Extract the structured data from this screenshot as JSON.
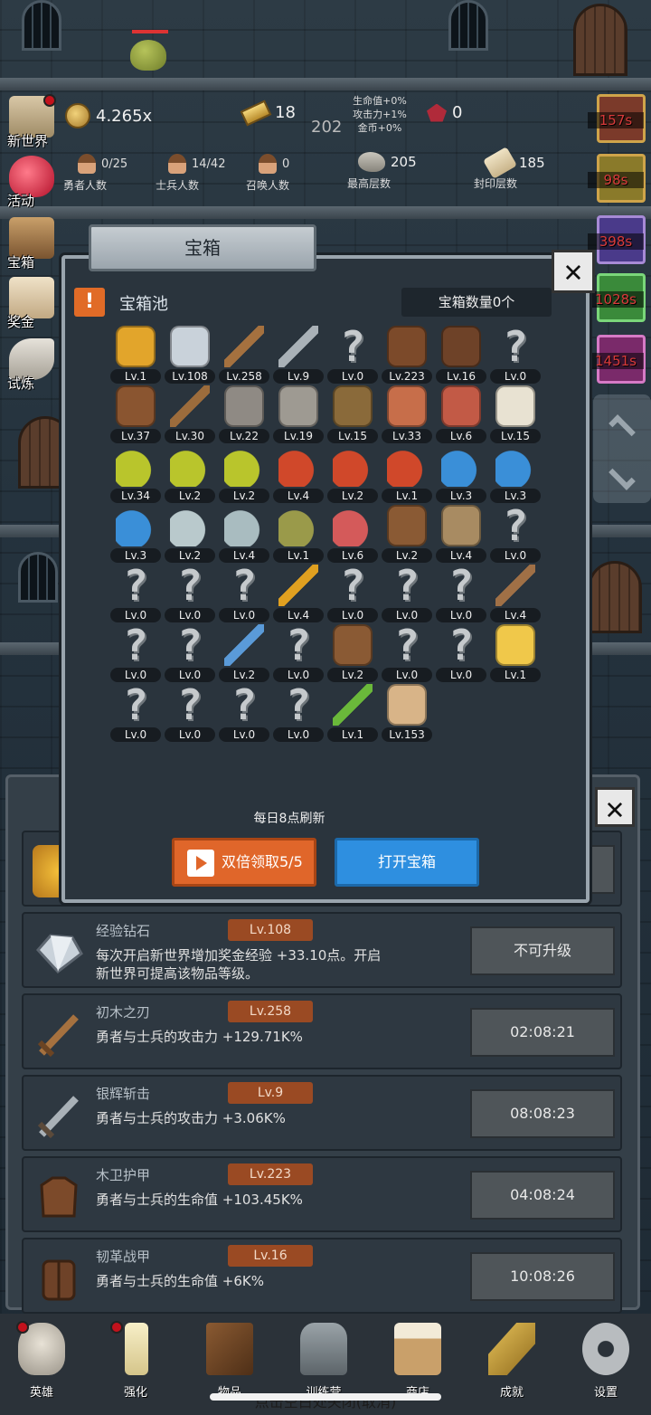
{
  "hud": {
    "gold": "4.265x",
    "bars": "18",
    "floor_center": "202",
    "ruby": "0",
    "bonus": [
      "生命值+0%",
      "攻击力+1%",
      "金币+0%"
    ],
    "heroes": "0/25",
    "heroes_label": "勇者人数",
    "soldiers": "14/42",
    "soldiers_label": "士兵人数",
    "summons": "0",
    "summons_label": "召唤人数",
    "max_floor": "205",
    "max_floor_label": "最高层数",
    "sealed_floor": "185",
    "sealed_floor_label": "封印层数"
  },
  "left_menu": [
    "新世界",
    "活动",
    "宝箱",
    "奖金",
    "试炼"
  ],
  "right_timers": [
    "157s",
    "98s",
    "398s",
    "1028s",
    "1451s"
  ],
  "dialog": {
    "title": "宝箱",
    "pool_title": "宝箱池",
    "count": "宝箱数量0个",
    "refresh": "每日8点刷新",
    "double_btn": "双倍领取5/5",
    "open_btn": "打开宝箱",
    "items": [
      {
        "icon": "crown-icon",
        "lv": "Lv.1"
      },
      {
        "icon": "diamond-icon",
        "lv": "Lv.108"
      },
      {
        "icon": "wood-sword-icon",
        "lv": "Lv.258"
      },
      {
        "icon": "silver-sword-icon",
        "lv": "Lv.9"
      },
      {
        "icon": "unknown-icon",
        "lv": "Lv.0"
      },
      {
        "icon": "leather-armor-icon",
        "lv": "Lv.223"
      },
      {
        "icon": "backpack-armor-icon",
        "lv": "Lv.16"
      },
      {
        "icon": "unknown-icon",
        "lv": "Lv.0"
      },
      {
        "icon": "leather-helmet-icon",
        "lv": "Lv.37"
      },
      {
        "icon": "dagger-icon",
        "lv": "Lv.30"
      },
      {
        "icon": "knight-helmet-icon",
        "lv": "Lv.22"
      },
      {
        "icon": "hammer-icon",
        "lv": "Lv.19"
      },
      {
        "icon": "great-helm-icon",
        "lv": "Lv.15"
      },
      {
        "icon": "ham-icon",
        "lv": "Lv.33"
      },
      {
        "icon": "steak-icon",
        "lv": "Lv.6"
      },
      {
        "icon": "rice-bowl-icon",
        "lv": "Lv.15"
      },
      {
        "icon": "yellow-potion-icon",
        "lv": "Lv.34"
      },
      {
        "icon": "yellow-flask-icon",
        "lv": "Lv.2"
      },
      {
        "icon": "yellow-round-potion-icon",
        "lv": "Lv.2"
      },
      {
        "icon": "red-potion-icon",
        "lv": "Lv.4"
      },
      {
        "icon": "red-flask-icon",
        "lv": "Lv.2"
      },
      {
        "icon": "red-round-potion-icon",
        "lv": "Lv.1"
      },
      {
        "icon": "blue-potion-icon",
        "lv": "Lv.3"
      },
      {
        "icon": "blue-flask-icon",
        "lv": "Lv.3"
      },
      {
        "icon": "blue-round-potion-icon",
        "lv": "Lv.3"
      },
      {
        "icon": "gray-vial-icon",
        "lv": "Lv.2"
      },
      {
        "icon": "gray-bottle-icon",
        "lv": "Lv.4"
      },
      {
        "icon": "green-bottle-icon",
        "lv": "Lv.1"
      },
      {
        "icon": "red-vial-icon",
        "lv": "Lv.6"
      },
      {
        "icon": "leather-boot-icon",
        "lv": "Lv.2"
      },
      {
        "icon": "cloth-boot-icon",
        "lv": "Lv.4"
      },
      {
        "icon": "unknown-icon",
        "lv": "Lv.0"
      },
      {
        "icon": "unknown-icon",
        "lv": "Lv.0"
      },
      {
        "icon": "unknown-icon",
        "lv": "Lv.0"
      },
      {
        "icon": "unknown-icon",
        "lv": "Lv.0"
      },
      {
        "icon": "torch-icon",
        "lv": "Lv.4"
      },
      {
        "icon": "unknown-icon",
        "lv": "Lv.0"
      },
      {
        "icon": "unknown-icon",
        "lv": "Lv.0"
      },
      {
        "icon": "unknown-icon",
        "lv": "Lv.0"
      },
      {
        "icon": "wood-staff-icon",
        "lv": "Lv.4"
      },
      {
        "icon": "unknown-icon",
        "lv": "Lv.0"
      },
      {
        "icon": "unknown-icon",
        "lv": "Lv.0"
      },
      {
        "icon": "blue-wand-icon",
        "lv": "Lv.2"
      },
      {
        "icon": "unknown-icon",
        "lv": "Lv.0"
      },
      {
        "icon": "travel-bag-icon",
        "lv": "Lv.2"
      },
      {
        "icon": "unknown-icon",
        "lv": "Lv.0"
      },
      {
        "icon": "unknown-icon",
        "lv": "Lv.0"
      },
      {
        "icon": "cheese-icon",
        "lv": "Lv.1"
      },
      {
        "icon": "unknown-icon",
        "lv": "Lv.0"
      },
      {
        "icon": "unknown-icon",
        "lv": "Lv.0"
      },
      {
        "icon": "unknown-icon",
        "lv": "Lv.0"
      },
      {
        "icon": "unknown-icon",
        "lv": "Lv.0"
      },
      {
        "icon": "green-wand-icon",
        "lv": "Lv.1"
      },
      {
        "icon": "beer-mug-icon",
        "lv": "Lv.153"
      }
    ]
  },
  "list": [
    {
      "name": "经验钻石",
      "lv": "Lv.108",
      "desc": "每次开启新世界增加奖金经验 +33.10点。开启新世界可提高该物品等级。",
      "btn": "不可升级"
    },
    {
      "name": "初木之刃",
      "lv": "Lv.258",
      "desc": "勇者与士兵的攻击力 +129.71K%",
      "btn": "02:08:21"
    },
    {
      "name": "银辉斩击",
      "lv": "Lv.9",
      "desc": "勇者与士兵的攻击力 +3.06K%",
      "btn": "08:08:23"
    },
    {
      "name": "木卫护甲",
      "lv": "Lv.223",
      "desc": "勇者与士兵的生命值 +103.45K%",
      "btn": "04:08:24"
    },
    {
      "name": "韧革战甲",
      "lv": "Lv.16",
      "desc": "勇者与士兵的生命值 +6K%",
      "btn": "10:08:26"
    }
  ],
  "nav": [
    "英雄",
    "强化",
    "物品",
    "训练营",
    "商店",
    "成就",
    "设置"
  ],
  "hint": "点击空白处关闭(取消)",
  "colors": {
    "accent_orange": "#e0662a",
    "accent_blue": "#2e8fe0",
    "level_badge": "#9a4a23",
    "timer_red": "#d73a3a"
  }
}
